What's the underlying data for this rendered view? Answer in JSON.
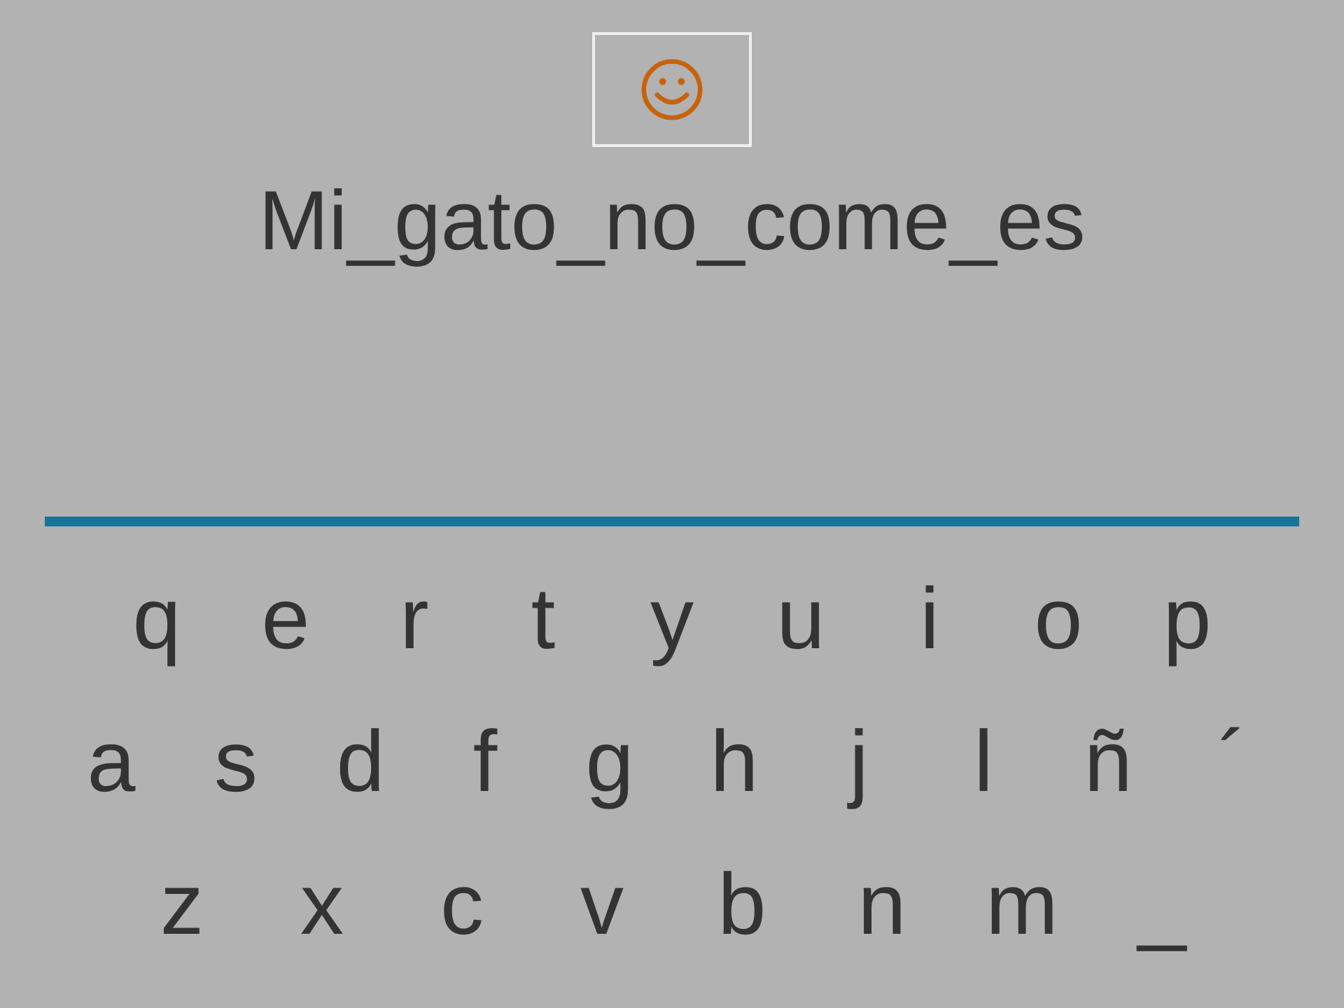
{
  "prompt": "Mi_gato_no_come_es",
  "keyboard": {
    "rows": [
      [
        "q",
        "e",
        "r",
        "t",
        "y",
        "u",
        "i",
        "o",
        "p"
      ],
      [
        "a",
        "s",
        "d",
        "f",
        "g",
        "h",
        "j",
        "l",
        "ñ",
        "´"
      ],
      [
        "z",
        "x",
        "c",
        "v",
        "b",
        "n",
        "m",
        "_"
      ]
    ]
  }
}
